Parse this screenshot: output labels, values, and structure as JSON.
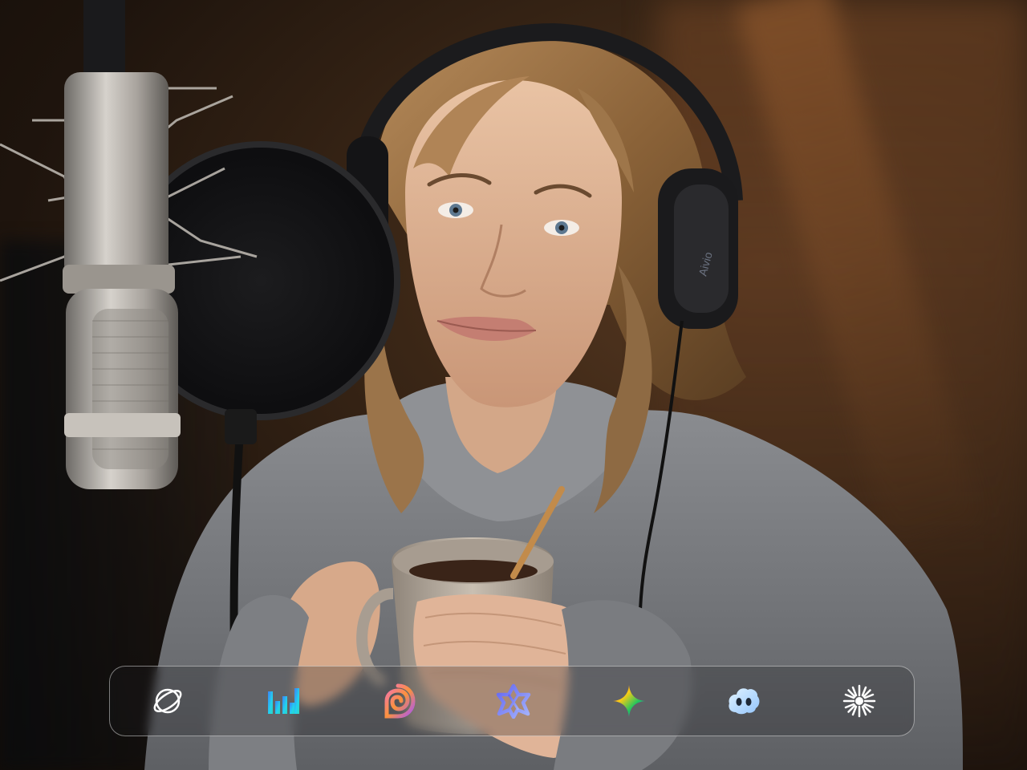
{
  "dock": {
    "apps": [
      {
        "id": "app-1",
        "icon": "orbit-ring-icon",
        "color": "#ffffff"
      },
      {
        "id": "app-2",
        "icon": "bar-chart-icon",
        "colors": [
          "#3b82f6",
          "#22d3ee",
          "#2dd4bf"
        ]
      },
      {
        "id": "app-3",
        "icon": "spiral-swirl-icon",
        "colors": [
          "#f472b6",
          "#fb923c",
          "#a855f7"
        ]
      },
      {
        "id": "app-4",
        "icon": "star-hexagram-icon",
        "colors": [
          "#6366f1",
          "#a5b4fc"
        ]
      },
      {
        "id": "app-5",
        "icon": "sparkle-diamond-icon",
        "colors": [
          "#ef4444",
          "#facc15",
          "#22c55e",
          "#3b82f6"
        ]
      },
      {
        "id": "app-6",
        "icon": "cloud-face-icon",
        "colors": [
          "#e0f2fe",
          "#93c5fd"
        ]
      },
      {
        "id": "app-7",
        "icon": "sunburst-icon",
        "color": "#ffffff"
      }
    ]
  }
}
